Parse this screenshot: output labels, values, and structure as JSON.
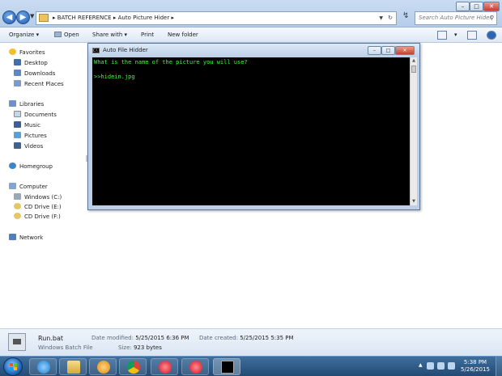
{
  "explorer": {
    "breadcrumb": [
      "BATCH REFERENCE",
      "Auto Picture Hider"
    ],
    "search_placeholder": "Search Auto Picture Hider"
  },
  "toolbar": {
    "organize": "Organize",
    "open": "Open",
    "share_with": "Share with",
    "print": "Print",
    "new_folder": "New folder"
  },
  "nav": {
    "favorites": "Favorites",
    "desktop": "Desktop",
    "downloads": "Downloads",
    "recent_places": "Recent Places",
    "libraries": "Libraries",
    "documents": "Documents",
    "music": "Music",
    "pictures": "Pictures",
    "videos": "Videos",
    "homegroup": "Homegroup",
    "computer": "Computer",
    "windows_c": "Windows (C:)",
    "cd_e": "CD Drive (E:)",
    "cd_f": "CD Drive (F:)",
    "network": "Network"
  },
  "console": {
    "title": "Auto File Hidder",
    "icon_text": "C:\\",
    "lines": [
      "What is the name of the picture you will use?",
      "",
      ">>hidein.jpg"
    ]
  },
  "details": {
    "file_name": "Run.bat",
    "file_type": "Windows Batch File",
    "modified_label": "Date modified:",
    "modified_value": "5/25/2015 6:36 PM",
    "created_label": "Date created:",
    "created_value": "5/25/2015 5:35 PM",
    "size_label": "Size:",
    "size_value": "923 bytes"
  },
  "taskbar": {
    "apps": [
      "internet-explorer",
      "windows-explorer",
      "media-player",
      "chrome",
      "itunes",
      "itunes",
      "command-prompt"
    ],
    "time": "5:38 PM",
    "date": "5/26/2015"
  },
  "colors": {
    "console_text": "#39ff39",
    "console_bg": "#000000",
    "taskbar": "#2b5580"
  }
}
